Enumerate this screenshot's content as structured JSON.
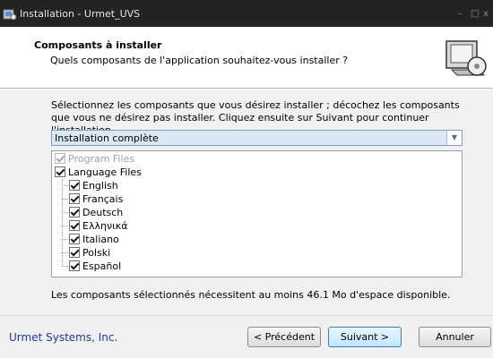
{
  "window": {
    "title": "Installation - Urmet_UVS",
    "minimize": "–",
    "maximize": "□",
    "close": "x"
  },
  "header": {
    "title": "Composants à installer",
    "subtitle": "Quels composants de l'application souhaitez-vous installer ?"
  },
  "body": {
    "instructions": "Sélectionnez les composants que vous désirez installer ; décochez les composants que vous ne désirez pas installer. Cliquez ensuite sur Suivant pour continuer l'installation.",
    "setup_type": "Installation complète",
    "components": [
      {
        "label": "Program Files",
        "checked": true,
        "disabled": true
      },
      {
        "label": "Language Files",
        "checked": true,
        "disabled": false
      },
      {
        "label": "English",
        "checked": true
      },
      {
        "label": "Français",
        "checked": true
      },
      {
        "label": "Deutsch",
        "checked": true
      },
      {
        "label": "Ελληνικά",
        "checked": true
      },
      {
        "label": "Italiano",
        "checked": true
      },
      {
        "label": "Polski",
        "checked": true
      },
      {
        "label": "Español",
        "checked": true
      }
    ],
    "space_required": "Les composants sélectionnés nécessitent au moins 46.1 Mo d'espace disponible."
  },
  "footer": {
    "company": "Urmet Systems, Inc.",
    "back_label": "< Précédent",
    "next_label": "Suivant >",
    "cancel_label": "Annuler"
  }
}
